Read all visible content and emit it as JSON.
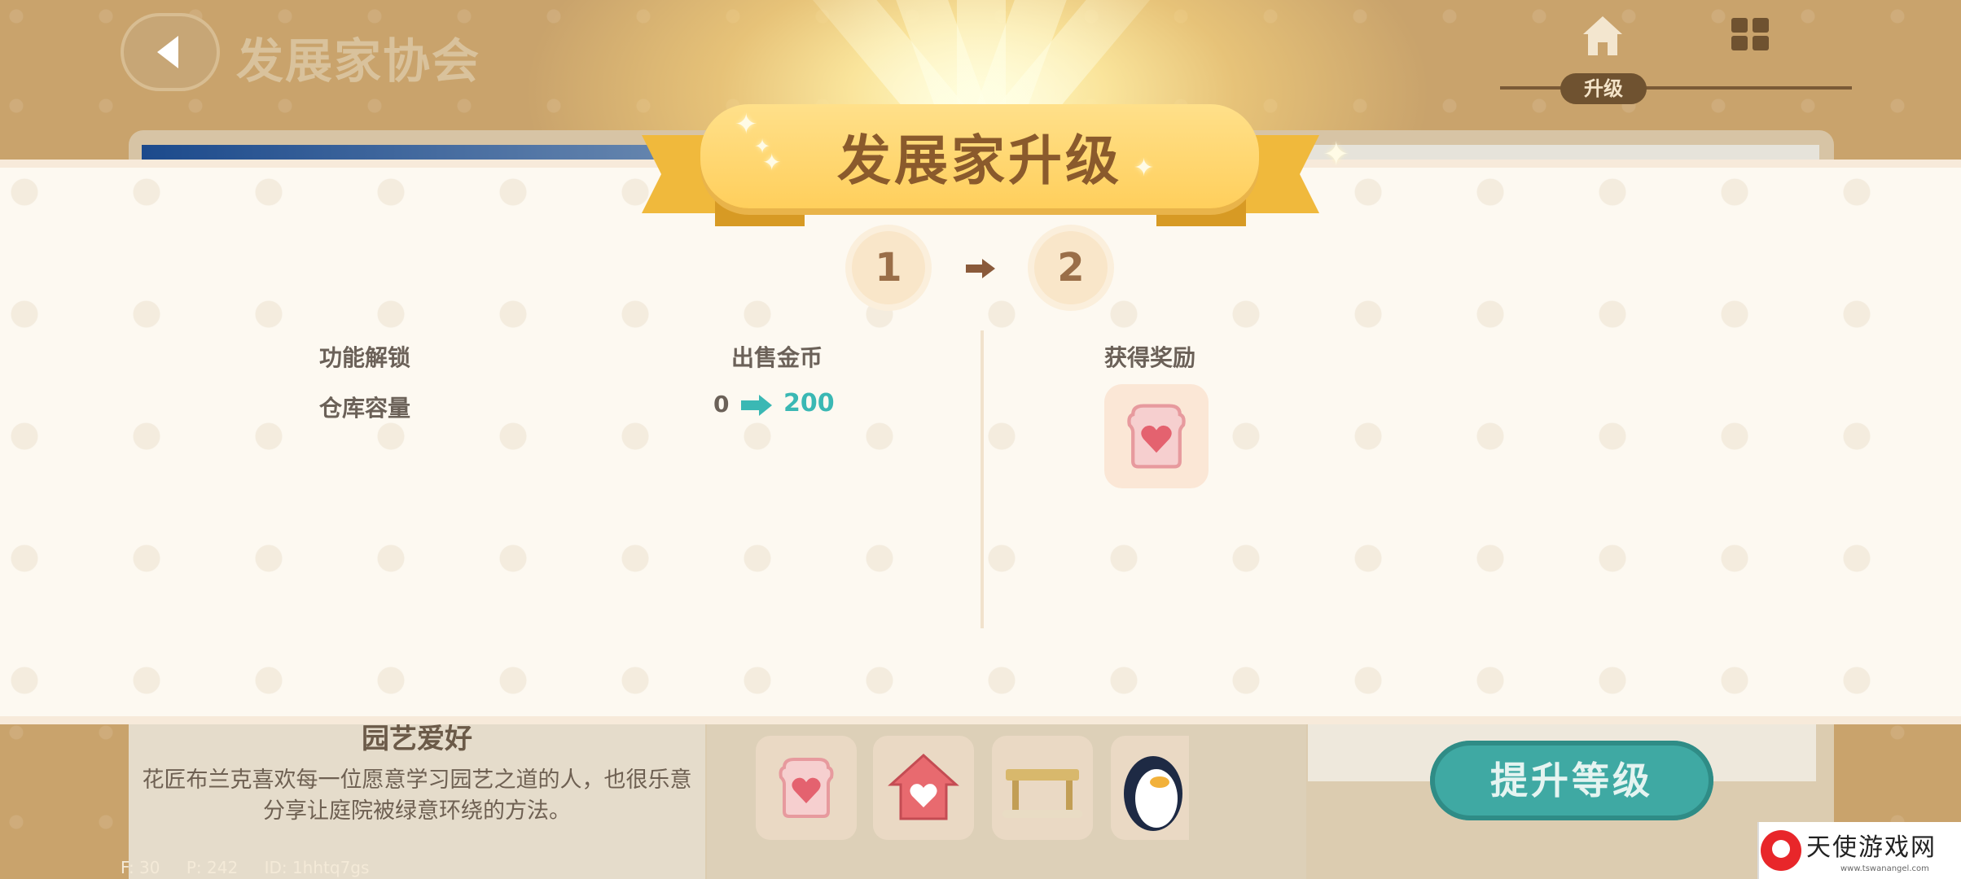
{
  "screen": {
    "title": "发展家协会",
    "tab_label": "升级",
    "icons": [
      "back-chevron-icon",
      "home-icon",
      "cards-icon"
    ]
  },
  "background_panel": {
    "hobby_title": "园艺爱好",
    "hobby_description": "花匠布兰克喜欢每一位愿意学习园艺之道的人，也很乐意分享让庭院被绿意环绕的方法。",
    "items": [
      "heart-toast-icon",
      "heart-house-icon",
      "wooden-bench-icon",
      "penguin-icon"
    ],
    "upgrade_button": "提升等级",
    "debug": {
      "f": "F: 30",
      "p": "P: 242",
      "id": "ID: 1hhtq7gs"
    }
  },
  "modal": {
    "title": "发展家升级",
    "level_from": "1",
    "level_to": "2",
    "left": {
      "header_function": "功能解锁",
      "header_coins": "出售金币",
      "row_label": "仓库容量",
      "row_from": "0",
      "row_to": "200"
    },
    "right": {
      "header": "获得奖励",
      "reward_icon": "heart-toast-icon"
    }
  },
  "colors": {
    "accent_teal": "#3ab8b4",
    "banner_yellow": "#ffd36a",
    "title_brown": "#8a5a2c",
    "modal_bg": "#fdf9f1"
  },
  "watermark": {
    "text": "天使游戏网",
    "url": "www.tswanangel.com"
  }
}
